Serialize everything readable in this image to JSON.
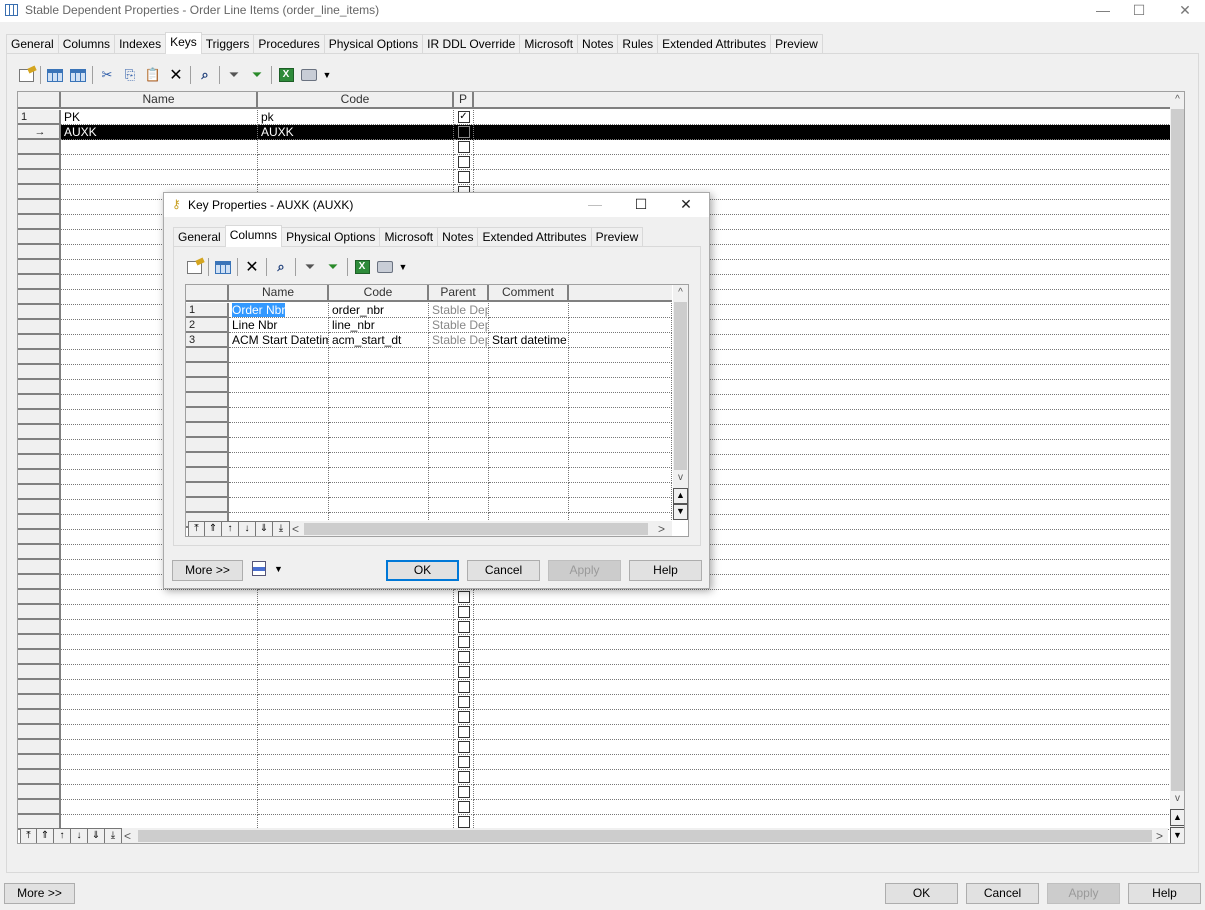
{
  "window": {
    "title": "Stable Dependent Properties - Order Line Items (order_line_items)",
    "icon": "table-icon",
    "controls": {
      "minimize": "—",
      "maximize": "☐",
      "close": "✕"
    }
  },
  "main": {
    "tabs": [
      {
        "label": "General"
      },
      {
        "label": "Columns"
      },
      {
        "label": "Indexes"
      },
      {
        "label": "Keys",
        "active": true
      },
      {
        "label": "Triggers"
      },
      {
        "label": "Procedures"
      },
      {
        "label": "Physical Options"
      },
      {
        "label": "IR DDL Override"
      },
      {
        "label": "Microsoft"
      },
      {
        "label": "Notes"
      },
      {
        "label": "Rules"
      },
      {
        "label": "Extended Attributes"
      },
      {
        "label": "Preview"
      }
    ],
    "toolbar": [
      "properties-icon",
      "insert-row-icon",
      "add-row-icon",
      "cut-icon",
      "copy-icon",
      "paste-icon",
      "delete-icon",
      "find-icon",
      "filter-icon",
      "filter-check-icon",
      "excel-icon",
      "print-icon"
    ],
    "grid": {
      "columns": [
        "Name",
        "Code",
        "P"
      ],
      "rows": [
        {
          "num": "1",
          "name": "PK",
          "code": "pk",
          "primary": true
        },
        {
          "num": "→",
          "name": "AUXK",
          "code": "AUXK",
          "primary": false,
          "selected": true
        }
      ]
    },
    "buttons": {
      "more": "More >>",
      "ok": "OK",
      "cancel": "Cancel",
      "apply": "Apply",
      "help": "Help"
    }
  },
  "dialog": {
    "title": "Key Properties - AUXK (AUXK)",
    "icon": "key-icon",
    "controls": {
      "minimize": "—",
      "maximize": "☐",
      "close": "✕"
    },
    "tabs": [
      {
        "label": "General"
      },
      {
        "label": "Columns",
        "active": true
      },
      {
        "label": "Physical Options"
      },
      {
        "label": "Microsoft"
      },
      {
        "label": "Notes"
      },
      {
        "label": "Extended Attributes"
      },
      {
        "label": "Preview"
      }
    ],
    "grid": {
      "columns": [
        "Name",
        "Code",
        "Parent",
        "Comment"
      ],
      "rows": [
        {
          "num": "1",
          "name": "Order Nbr",
          "code": "order_nbr",
          "parent": "Stable Dep",
          "comment": ""
        },
        {
          "num": "2",
          "name": "Line Nbr",
          "code": "line_nbr",
          "parent": "Stable Dep",
          "comment": ""
        },
        {
          "num": "3",
          "name": "ACM Start Datetime",
          "code": "acm_start_dt",
          "parent": "Stable Dep",
          "comment": "Start datetime o"
        }
      ]
    },
    "buttons": {
      "more": "More >>",
      "ok": "OK",
      "cancel": "Cancel",
      "apply": "Apply",
      "help": "Help"
    }
  },
  "nav": {
    "first": "⤒",
    "prev_page": "⇑",
    "prev": "↑",
    "next": "↓",
    "next_page": "⇓",
    "last": "⤓",
    "left": "<",
    "right": ">",
    "up": "^",
    "down": "v"
  }
}
